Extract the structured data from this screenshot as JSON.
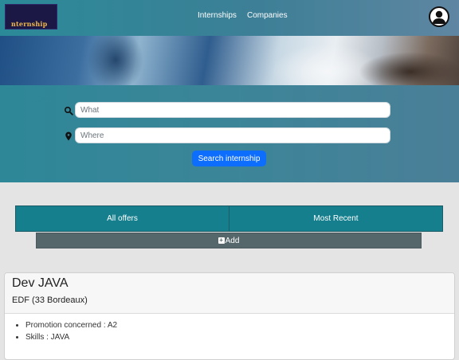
{
  "header": {
    "logo_text": "nternship",
    "nav": {
      "internships": "Internships",
      "companies": "Companies"
    },
    "account_icon": "user-circle-icon"
  },
  "search": {
    "what_placeholder": "What",
    "where_placeholder": "Where",
    "what_icon": "search-icon",
    "where_icon": "map-marker-icon",
    "button_label": "Search internship"
  },
  "tabs": {
    "all_offers": "All offers",
    "most_recent": "Most Recent"
  },
  "add_button": {
    "label": "Add",
    "icon": "plus-square-icon"
  },
  "offer": {
    "title": "Dev JAVA",
    "company": "EDF (33 Bordeaux)",
    "details": [
      "Promotion concerned : A2",
      "Skills : JAVA"
    ]
  },
  "colors": {
    "header": "#2b8a98",
    "search_button": "#0d6efd",
    "tab": "#157f8e",
    "add_button": "#56676b",
    "page_bg": "#e4e4e4"
  }
}
